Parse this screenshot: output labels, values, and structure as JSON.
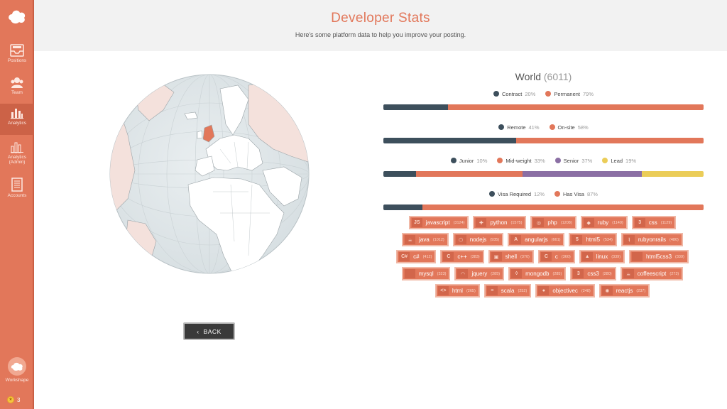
{
  "sidebar": {
    "items": [
      {
        "label": "Positions",
        "icon": "inbox-icon"
      },
      {
        "label": "Team",
        "icon": "team-icon"
      },
      {
        "label": "Analytics",
        "icon": "bar-chart-icon",
        "active": true
      },
      {
        "label_line1": "Analytics",
        "label_line2": "(Admin)",
        "icon": "bar-chart-admin-icon"
      },
      {
        "label": "Accounts",
        "icon": "ledger-icon"
      }
    ],
    "workshape_label": "Workshape",
    "coins": "3"
  },
  "header": {
    "title": "Developer Stats",
    "subtitle": "Here's some platform data to help you improve your posting."
  },
  "back_label": "BACK",
  "stats": {
    "region": "World",
    "total": "(6011)",
    "groups": [
      {
        "segments": [
          {
            "label": "Contract",
            "pct": "20%",
            "value": 20,
            "color": "#3d4f5c"
          },
          {
            "label": "Permanent",
            "pct": "79%",
            "value": 79,
            "color": "#e2775a"
          }
        ]
      },
      {
        "segments": [
          {
            "label": "Remote",
            "pct": "41%",
            "value": 41,
            "color": "#3d4f5c"
          },
          {
            "label": "On-site",
            "pct": "58%",
            "value": 58,
            "color": "#e2775a"
          }
        ]
      },
      {
        "segments": [
          {
            "label": "Junior",
            "pct": "10%",
            "value": 10,
            "color": "#3d4f5c"
          },
          {
            "label": "Mid-weight",
            "pct": "33%",
            "value": 33,
            "color": "#e2775a"
          },
          {
            "label": "Senior",
            "pct": "37%",
            "value": 37,
            "color": "#8b6fa4"
          },
          {
            "label": "Lead",
            "pct": "19%",
            "value": 19,
            "color": "#ebcd58"
          }
        ]
      },
      {
        "segments": [
          {
            "label": "Visa Required",
            "pct": "12%",
            "value": 12,
            "color": "#3d4f5c"
          },
          {
            "label": "Has Visa",
            "pct": "87%",
            "value": 87,
            "color": "#e2775a"
          }
        ]
      }
    ]
  },
  "tags": [
    [
      {
        "name": "javascript",
        "count": "(3124)",
        "icon": "JS"
      },
      {
        "name": "python",
        "count": "(1575)",
        "icon": "✚"
      },
      {
        "name": "php",
        "count": "(1208)",
        "icon": "◎"
      },
      {
        "name": "ruby",
        "count": "(1140)",
        "icon": "◆"
      },
      {
        "name": "css",
        "count": "(1129)",
        "icon": "3"
      }
    ],
    [
      {
        "name": "java",
        "count": "(1012)",
        "icon": "☕"
      },
      {
        "name": "nodejs",
        "count": "(935)",
        "icon": "⬡"
      },
      {
        "name": "angularjs",
        "count": "(661)",
        "icon": "A"
      },
      {
        "name": "html5",
        "count": "(534)",
        "icon": "5"
      },
      {
        "name": "rubyonrails",
        "count": "(480)",
        "icon": "⌇"
      }
    ],
    [
      {
        "name": "c#",
        "count": "(412)",
        "icon": "C#"
      },
      {
        "name": "c++",
        "count": "(383)",
        "icon": "C"
      },
      {
        "name": "shell",
        "count": "(370)",
        "icon": "▣"
      },
      {
        "name": "c",
        "count": "(360)",
        "icon": "C"
      },
      {
        "name": "linux",
        "count": "(339)",
        "icon": "▲"
      },
      {
        "name": "html5css3",
        "count": "(339)",
        "icon": ""
      }
    ],
    [
      {
        "name": "mysql",
        "count": "(323)",
        "icon": ""
      },
      {
        "name": "jquery",
        "count": "(285)",
        "icon": "◠"
      },
      {
        "name": "mongodb",
        "count": "(285)",
        "icon": "◊"
      },
      {
        "name": "css3",
        "count": "(280)",
        "icon": "3"
      },
      {
        "name": "coffeescript",
        "count": "(273)",
        "icon": "☕"
      }
    ],
    [
      {
        "name": "html",
        "count": "(265)",
        "icon": "<>"
      },
      {
        "name": "scala",
        "count": "(252)",
        "icon": "≡"
      },
      {
        "name": "objectivec",
        "count": "(248)",
        "icon": "●"
      },
      {
        "name": "reactjs",
        "count": "(237)",
        "icon": "✺"
      }
    ]
  ]
}
